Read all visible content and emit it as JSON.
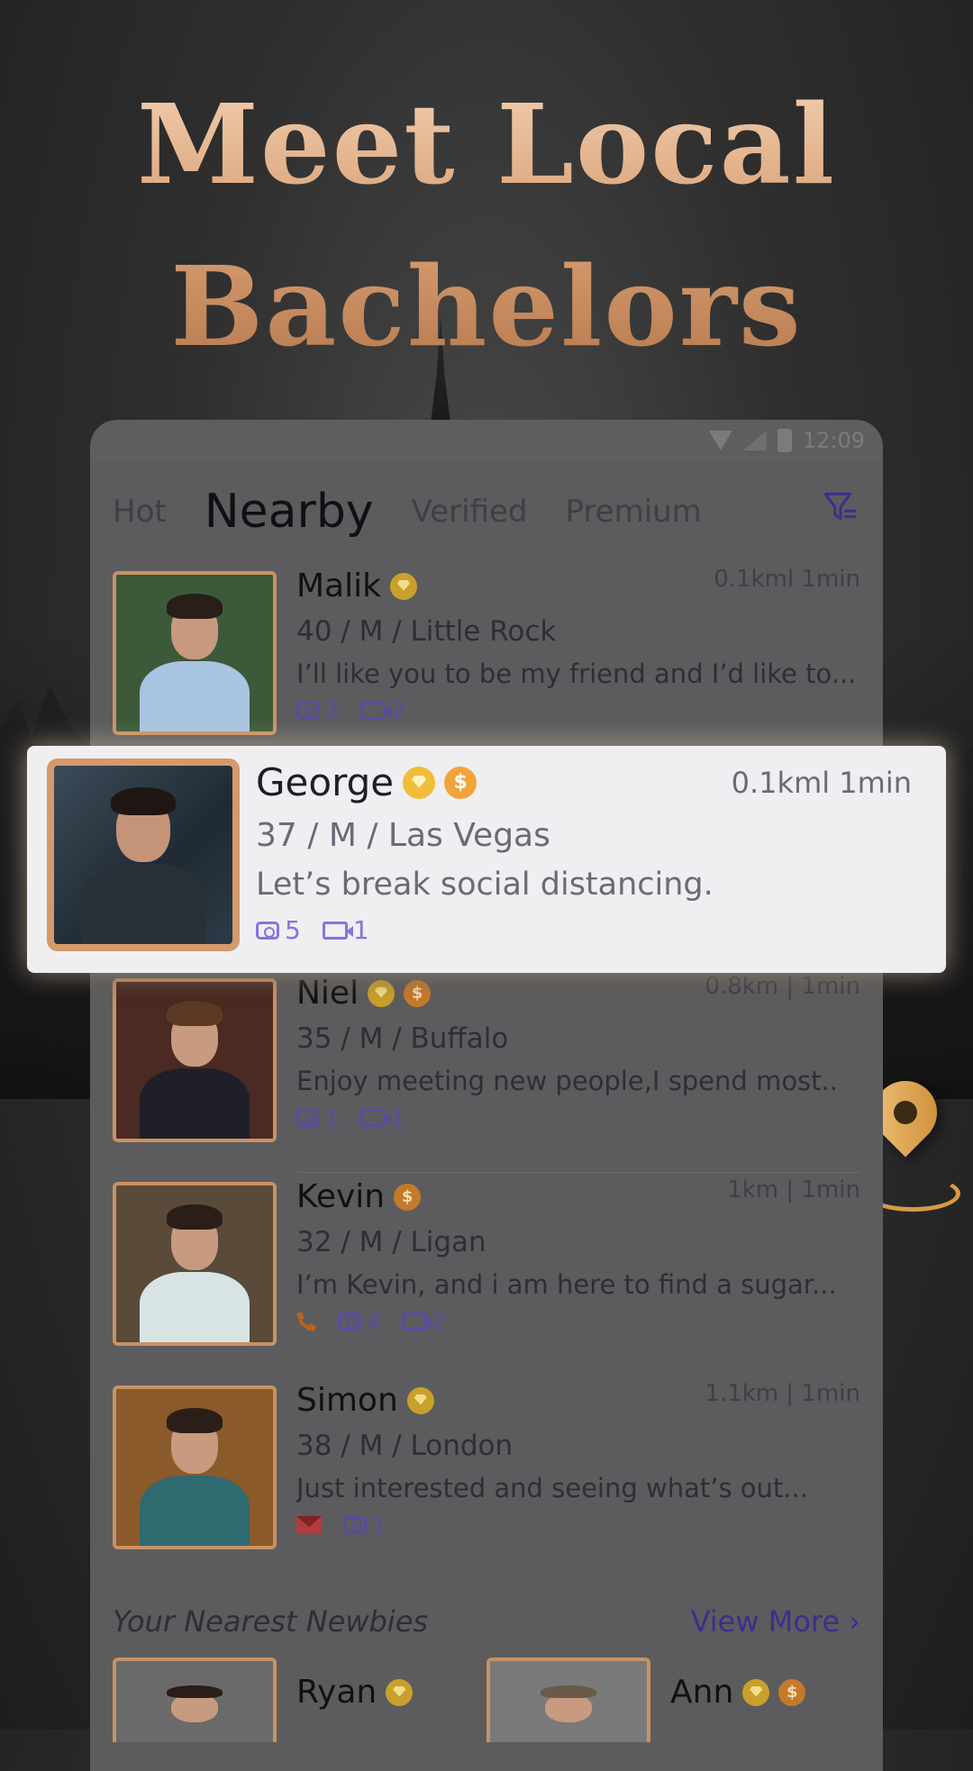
{
  "hero": {
    "line1": "Meet Local",
    "line2": "Bachelors"
  },
  "status": {
    "time": "12:09"
  },
  "tabs": [
    "Hot",
    "Nearby",
    "Verified",
    "Premium"
  ],
  "active_tab": "Nearby",
  "profiles": [
    {
      "name": "Malik",
      "meta": "40 / M / Little Rock",
      "bio": "I’ll like you to be my friend and I’d like to...",
      "distance": "0.1kml 1min",
      "photos": "2",
      "videos": "2",
      "badges": [
        "diamond"
      ],
      "colors": {
        "bg": "#3c5a3a",
        "shirt": "#a9c4e0"
      }
    },
    {
      "name": "Niel",
      "meta": "35 / M / Buffalo",
      "bio": "Enjoy meeting new people,I spend most..",
      "distance": "0.8km | 1min",
      "photos": "1",
      "videos": "1",
      "badges": [
        "diamond",
        "coin"
      ],
      "colors": {
        "bg": "#4a2a22",
        "shirt": "#1f1f2a"
      }
    },
    {
      "name": "Kevin",
      "meta": "32 / M / Ligan",
      "bio": "I’m Kevin, and i am here to find a sugar...",
      "distance": "1km | 1min",
      "photos": "4",
      "videos": "2",
      "badges": [
        "coin"
      ],
      "has_call": true,
      "colors": {
        "bg": "#5a4a3a",
        "shirt": "#d8e4e4"
      }
    },
    {
      "name": "Simon",
      "meta": "38 / M / London",
      "bio": "Just interested and seeing what’s out...",
      "distance": "1.1km | 1min",
      "photos": "1",
      "badges": [
        "diamond"
      ],
      "has_mail": true,
      "colors": {
        "bg": "#8a5a2a",
        "shirt": "#2f6a70"
      }
    }
  ],
  "highlight": {
    "name": "George",
    "meta": "37 / M / Las Vegas",
    "bio": "Let’s break social distancing.",
    "distance": "0.1kml 1min",
    "photos": "5",
    "videos": "1",
    "badges": [
      "diamond",
      "coin"
    ]
  },
  "newbies": {
    "title": "Your Nearest Newbies",
    "view_more": "View More ›",
    "items": [
      {
        "name": "Ryan",
        "badges": [
          "diamond"
        ]
      },
      {
        "name": "Ann",
        "badges": [
          "diamond",
          "coin"
        ]
      }
    ]
  },
  "colors": {
    "accent": "#8a72e0",
    "gold": "#d49a6b",
    "title_gold": "#d59c70"
  }
}
